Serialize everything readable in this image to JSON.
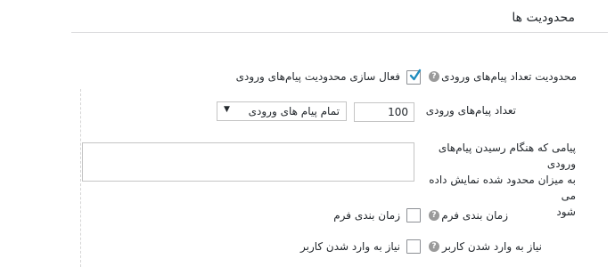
{
  "section": {
    "title": "محدودیت ها"
  },
  "incoming_limit": {
    "label": "محدودیت تعداد پیام‌های ورودی",
    "help": "?",
    "checkbox_checked": true,
    "checkbox_text": "فعال سازی محدودیت پیام‌های ورودی"
  },
  "incoming_count": {
    "label": "تعداد پیام‌های ورودی",
    "value": "100",
    "select_value": "تمام پیام های ورودی",
    "select_arrow": "▼"
  },
  "limit_message": {
    "label_lines": [
      "پیامی که هنگام رسیدن پیام‌های ورودی",
      "به میزان محدود شده نمایش داده می",
      "شود"
    ],
    "value": ""
  },
  "form_schedule": {
    "label": "زمان بندی فرم",
    "help": "?",
    "checkbox_checked": false,
    "checkbox_text": "زمان بندی فرم"
  },
  "login_required": {
    "label": "نیاز به وارد شدن کاربر",
    "help": "?",
    "checkbox_checked": false,
    "checkbox_text": "نیاز به وارد شدن کاربر"
  }
}
